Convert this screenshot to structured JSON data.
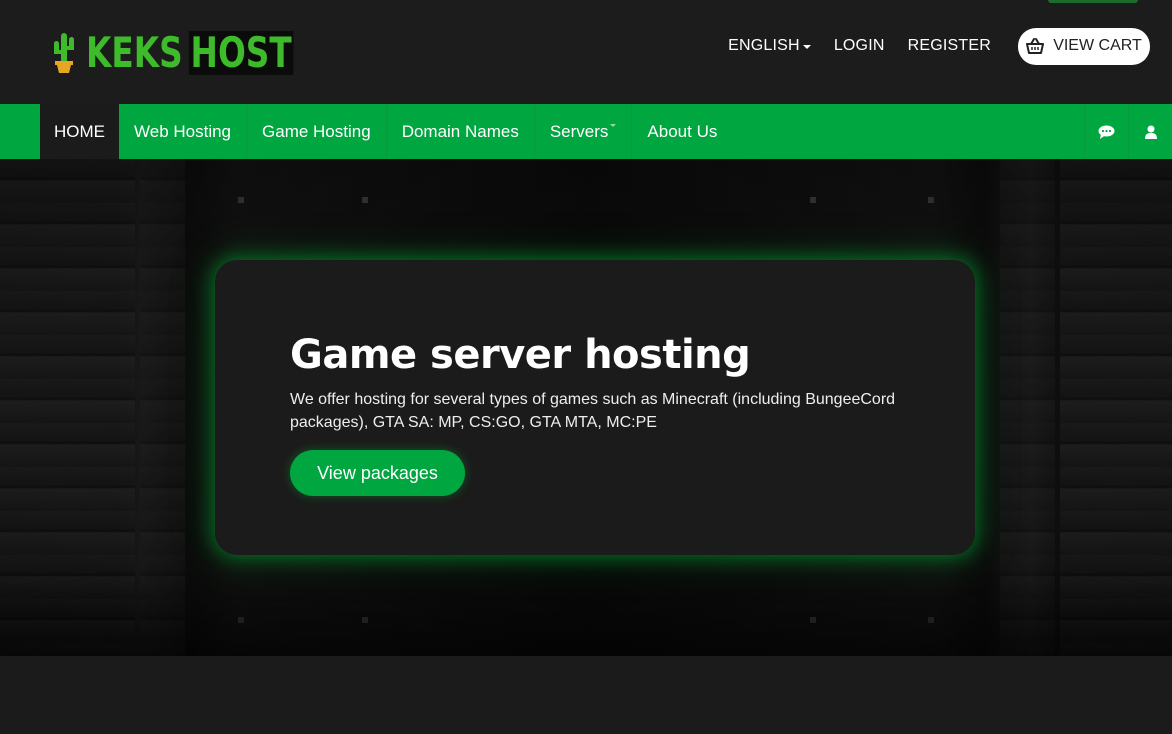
{
  "header": {
    "logo_word1": "KEKS",
    "logo_word2": "HOST",
    "language_label": "ENGLISH",
    "login_label": "LOGIN",
    "register_label": "REGISTER",
    "cart_label": "VIEW CART"
  },
  "nav": {
    "items": [
      {
        "label": "HOME",
        "active": true
      },
      {
        "label": "Web Hosting"
      },
      {
        "label": "Game Hosting"
      },
      {
        "label": "Domain Names"
      },
      {
        "label": "Servers"
      },
      {
        "label": "About Us"
      }
    ],
    "icons": [
      "chat-icon",
      "user-icon"
    ]
  },
  "hero": {
    "title": "Game server hosting",
    "description": "We offer hosting for several types of games such as Minecraft (including BungeeCord packages), GTA SA: MP, CS:GO, GTA MTA, MC:PE",
    "button_label": "View packages"
  },
  "colors": {
    "brand_green": "#00a63f",
    "logo_green": "#3dbb2a",
    "background": "#1b1b1b"
  }
}
